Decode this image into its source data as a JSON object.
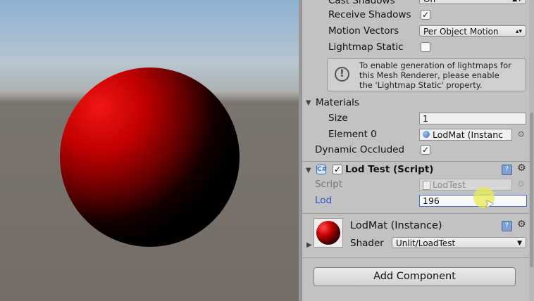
{
  "inspector": {
    "mesh_renderer": {
      "cast_shadows": {
        "label": "Cast Shadows",
        "value": "On"
      },
      "receive_shadows": {
        "label": "Receive Shadows",
        "checked": true
      },
      "motion_vectors": {
        "label": "Motion Vectors",
        "value": "Per Object Motion"
      },
      "lightmap_static": {
        "label": "Lightmap Static",
        "checked": false
      },
      "help_lines": [
        "To enable generation of lightmaps for",
        "this Mesh Renderer, please enable",
        "the 'Lightmap Static' property."
      ],
      "materials": {
        "label": "Materials",
        "size_label": "Size",
        "size_value": "1",
        "element0_label": "Element 0",
        "element0_value": "LodMat (Instanc"
      },
      "dynamic_occluded": {
        "label": "Dynamic Occluded",
        "checked": true
      }
    },
    "lod_test": {
      "title": "Lod Test (Script)",
      "enabled": true,
      "script_label": "Script",
      "script_value": "LodTest",
      "lod_label": "Lod",
      "lod_value": "196"
    },
    "material": {
      "name": "LodMat (Instance)",
      "shader_label": "Shader",
      "shader_value": "Unlit/LoadTest"
    },
    "add_component_label": "Add Component"
  },
  "icons": {
    "check": "✓",
    "help": "!",
    "gear": "⚙",
    "target": "⊙"
  },
  "colors": {
    "panel_bg": "#c2c2c2",
    "lod_label": "#2a52c8",
    "sphere_red": "#d00000"
  }
}
